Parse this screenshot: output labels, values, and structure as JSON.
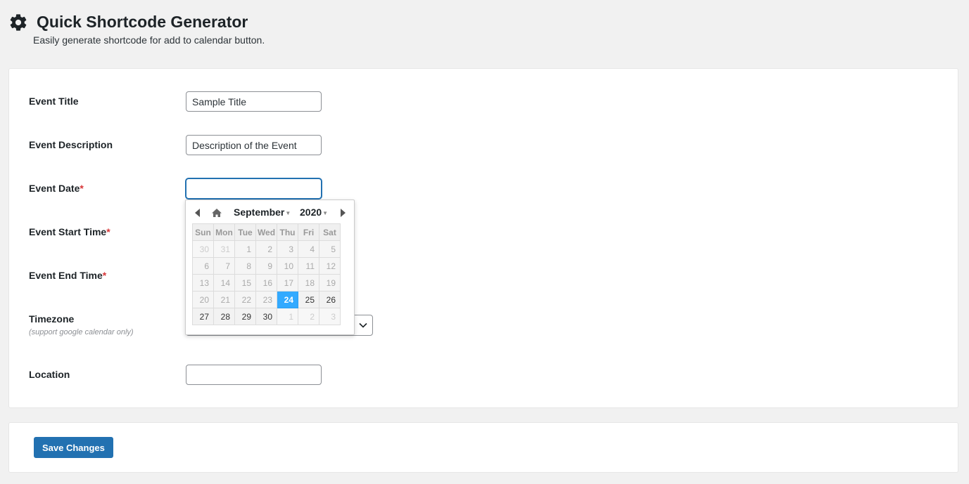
{
  "header": {
    "title": "Quick Shortcode Generator",
    "subtitle": "Easily generate shortcode for add to calendar button.",
    "icon": "gear-icon"
  },
  "form": {
    "event_title": {
      "label": "Event Title",
      "value": "Sample Title"
    },
    "event_description": {
      "label": "Event Description",
      "value": "Description of the Event"
    },
    "event_date": {
      "label": "Event Date",
      "required_mark": "*",
      "value": ""
    },
    "event_start_time": {
      "label": "Event Start Time",
      "required_mark": "*"
    },
    "event_end_time": {
      "label": "Event End Time",
      "required_mark": "*"
    },
    "timezone": {
      "label": "Timezone",
      "hint": "(support google calendar only)"
    },
    "location": {
      "label": "Location",
      "value": ""
    }
  },
  "datepicker": {
    "month": "September",
    "year": "2020",
    "weekdays": [
      "Sun",
      "Mon",
      "Tue",
      "Wed",
      "Thu",
      "Fri",
      "Sat"
    ],
    "weeks": [
      [
        {
          "d": "30",
          "t": "other"
        },
        {
          "d": "31",
          "t": "other"
        },
        {
          "d": "1",
          "t": "past"
        },
        {
          "d": "2",
          "t": "past"
        },
        {
          "d": "3",
          "t": "past"
        },
        {
          "d": "4",
          "t": "past"
        },
        {
          "d": "5",
          "t": "past"
        }
      ],
      [
        {
          "d": "6",
          "t": "past"
        },
        {
          "d": "7",
          "t": "past"
        },
        {
          "d": "8",
          "t": "past"
        },
        {
          "d": "9",
          "t": "past"
        },
        {
          "d": "10",
          "t": "past"
        },
        {
          "d": "11",
          "t": "past"
        },
        {
          "d": "12",
          "t": "past"
        }
      ],
      [
        {
          "d": "13",
          "t": "past"
        },
        {
          "d": "14",
          "t": "past"
        },
        {
          "d": "15",
          "t": "past"
        },
        {
          "d": "16",
          "t": "past"
        },
        {
          "d": "17",
          "t": "past"
        },
        {
          "d": "18",
          "t": "past"
        },
        {
          "d": "19",
          "t": "past"
        }
      ],
      [
        {
          "d": "20",
          "t": "past"
        },
        {
          "d": "21",
          "t": "past"
        },
        {
          "d": "22",
          "t": "past"
        },
        {
          "d": "23",
          "t": "past"
        },
        {
          "d": "24",
          "t": "sel"
        },
        {
          "d": "25",
          "t": "cur"
        },
        {
          "d": "26",
          "t": "cur"
        }
      ],
      [
        {
          "d": "27",
          "t": "cur"
        },
        {
          "d": "28",
          "t": "cur"
        },
        {
          "d": "29",
          "t": "cur"
        },
        {
          "d": "30",
          "t": "cur"
        },
        {
          "d": "1",
          "t": "other"
        },
        {
          "d": "2",
          "t": "other"
        },
        {
          "d": "3",
          "t": "other"
        }
      ]
    ],
    "selected_color": "#33aaff"
  },
  "actions": {
    "save_label": "Save Changes"
  },
  "colors": {
    "primary": "#2271b1",
    "required": "#d63638"
  }
}
